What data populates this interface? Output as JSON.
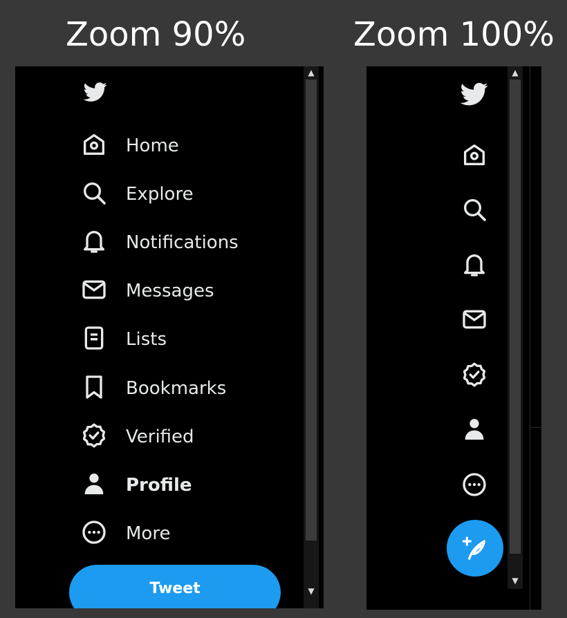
{
  "captions": {
    "left": "Zoom 90%",
    "right": "Zoom 100%"
  },
  "nav": [
    {
      "key": "home",
      "label": "Home",
      "icon": "home-icon"
    },
    {
      "key": "explore",
      "label": "Explore",
      "icon": "search-icon"
    },
    {
      "key": "notifications",
      "label": "Notifications",
      "icon": "bell-icon"
    },
    {
      "key": "messages",
      "label": "Messages",
      "icon": "envelope-icon"
    },
    {
      "key": "lists",
      "label": "Lists",
      "icon": "list-icon"
    },
    {
      "key": "bookmarks",
      "label": "Bookmarks",
      "icon": "bookmark-icon"
    },
    {
      "key": "verified",
      "label": "Verified",
      "icon": "verified-badge-icon"
    },
    {
      "key": "profile",
      "label": "Profile",
      "icon": "person-icon",
      "active": true
    },
    {
      "key": "more",
      "label": "More",
      "icon": "more-circle-icon"
    }
  ],
  "tweet_button": {
    "label": "Tweet"
  },
  "colors": {
    "accent": "#1d9bf0",
    "panel_bg": "#000000",
    "page_bg": "#383838",
    "text": "#e7e9ea"
  }
}
